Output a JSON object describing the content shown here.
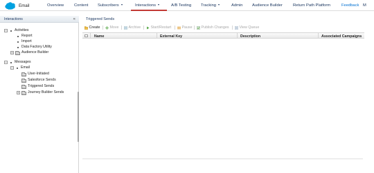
{
  "app": {
    "name": "Email"
  },
  "nav": {
    "items": [
      {
        "label": "Overview"
      },
      {
        "label": "Content"
      },
      {
        "label": "Subscribers"
      },
      {
        "label": "Interactions"
      },
      {
        "label": "A/B Testing"
      },
      {
        "label": "Tracking"
      },
      {
        "label": "Admin"
      },
      {
        "label": "Audience Builder"
      },
      {
        "label": "Return Path Platform"
      }
    ],
    "active": "Interactions",
    "feedback": "Feedback",
    "overflow": "M"
  },
  "left_panel": {
    "title": "Interactions",
    "collapse_glyph": "«",
    "tree": {
      "activities": "Activities",
      "report": "Report",
      "import": "Import",
      "data_factory": "Data Factory Utility",
      "audience_builder": "Audience Builder",
      "messages": "Messages",
      "email": "Email",
      "user_initiated": "User-Initiated",
      "salesforce_sends": "Salesforce Sends",
      "triggered_sends": "Triggered Sends",
      "journey_builder_sends": "Journey Builder Sends"
    }
  },
  "main": {
    "title": "Triggered Sends",
    "toolbar": {
      "create": "Create",
      "move": "Move",
      "archive": "Archive",
      "start_restart": "Start/Restart",
      "pause": "Pause",
      "publish_changes": "Publish Changes",
      "view_queue": "View Queue"
    },
    "columns": [
      "Name",
      "External Key",
      "Description",
      "Associated Campaigns"
    ]
  },
  "colors": {
    "accent": "#c23934",
    "link": "#0070d2",
    "nav_text": "#16325c",
    "logo": "#00a1e0"
  }
}
